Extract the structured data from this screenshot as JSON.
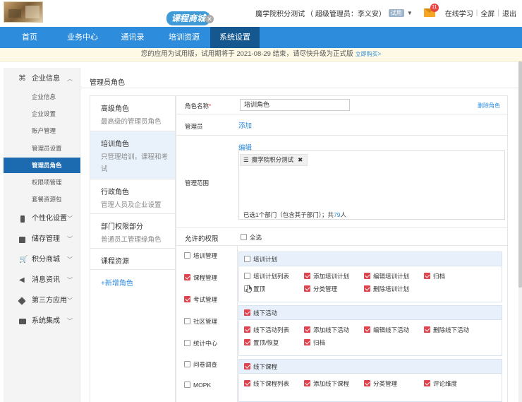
{
  "header": {
    "mall_label": "课程商城",
    "org_name": "魔学院积分测试",
    "admin_text": "（ 超级管理员：李义安）",
    "trial_badge": "试用",
    "mail_count": "11",
    "links": [
      "在线学习",
      "全屏",
      "退出"
    ]
  },
  "nav": {
    "items": [
      "首页",
      "业务中心",
      "通讯录",
      "培训资源",
      "系统设置"
    ],
    "active": "系统设置"
  },
  "notice": {
    "text": "您的应用为试用版，试用期将于 2021-08-29 结束，请尽快升级为正式版",
    "link": "立即购买>"
  },
  "sidebar": {
    "groups": [
      {
        "label": "企业信息",
        "icon": "command-icon",
        "expanded": true
      },
      {
        "label": "个性化设置",
        "icon": "phone-icon"
      },
      {
        "label": "储存管理",
        "icon": "storage-icon"
      },
      {
        "label": "积分商城",
        "icon": "cart-icon"
      },
      {
        "label": "消息资讯",
        "icon": "speaker-icon"
      },
      {
        "label": "第三方应用",
        "icon": "cube-icon"
      },
      {
        "label": "系统集成",
        "icon": "integration-icon"
      }
    ],
    "subitems": [
      "企业信息",
      "企业设置",
      "账户管理",
      "管理员设置",
      "管理员角色",
      "权限项管理",
      "套餐资源包"
    ],
    "active_subitem": "管理员角色"
  },
  "main": {
    "title": "管理员角色",
    "roles": [
      {
        "name": "高级角色",
        "desc": "最高级的管理员角色"
      },
      {
        "name": "培训角色",
        "desc": "只管理培训，课程和考试"
      },
      {
        "name": "行政角色",
        "desc": "管理人员及企业设置"
      },
      {
        "name": "部门权限部分",
        "desc": "普通员工管理缘角色"
      },
      {
        "name": "课程资源",
        "desc": ""
      }
    ],
    "active_role": "培训角色",
    "add_role": "+新增角色"
  },
  "form": {
    "role_name_label": "角色名称",
    "required_mark": "*",
    "role_name_value": "培训角色",
    "delete_role": "删除角色",
    "admin_label": "管理员",
    "add_admin": "添加",
    "scope_label": "管理范围",
    "edit_scope": "编辑",
    "scope_tag": "魔学院积分测试",
    "scope_summary_prefix": "已选1个部门（包含其子部门）；共",
    "scope_summary_count": "79",
    "scope_summary_suffix": "人",
    "perm_label": "允许的权限",
    "select_all": "全选"
  },
  "modules": [
    {
      "label": "培训管理",
      "checked": false
    },
    {
      "label": "课程管理",
      "checked": true
    },
    {
      "label": "考试管理",
      "checked": true
    },
    {
      "label": "社区管理",
      "checked": false
    },
    {
      "label": "统计中心",
      "checked": false
    },
    {
      "label": "问卷调查",
      "checked": false
    },
    {
      "label": "MOPK",
      "checked": false
    }
  ],
  "perm_groups": [
    {
      "title": "培训计划",
      "checked": false,
      "items": [
        {
          "label": "培训计划列表",
          "checked": false
        },
        {
          "label": "添加培训计划",
          "checked": true
        },
        {
          "label": "编辑培训计划",
          "checked": true
        },
        {
          "label": "归档",
          "checked": true
        },
        {
          "label": "置顶",
          "checked": false
        },
        {
          "label": "分类管理",
          "checked": true
        },
        {
          "label": "删除培训计划",
          "checked": true
        }
      ]
    },
    {
      "title": "线下活动",
      "checked": true,
      "items": [
        {
          "label": "线下活动列表",
          "checked": true
        },
        {
          "label": "添加线下活动",
          "checked": true
        },
        {
          "label": "编辑线下活动",
          "checked": true
        },
        {
          "label": "删除线下活动",
          "checked": true
        },
        {
          "label": "置顶/恢复",
          "checked": true
        },
        {
          "label": "归档",
          "checked": true
        }
      ]
    },
    {
      "title": "线下课程",
      "checked": true,
      "items": [
        {
          "label": "线下课程列表",
          "checked": true
        },
        {
          "label": "添加线下课程",
          "checked": true
        },
        {
          "label": "分类管理",
          "checked": true
        },
        {
          "label": "评论维度",
          "checked": true
        }
      ]
    }
  ],
  "colors": {
    "nav": "#2d8cdc",
    "nav_active": "#14588f",
    "sidebar_active": "#1c6bb0",
    "check": "#e0454f",
    "link": "#2d8cdc"
  }
}
